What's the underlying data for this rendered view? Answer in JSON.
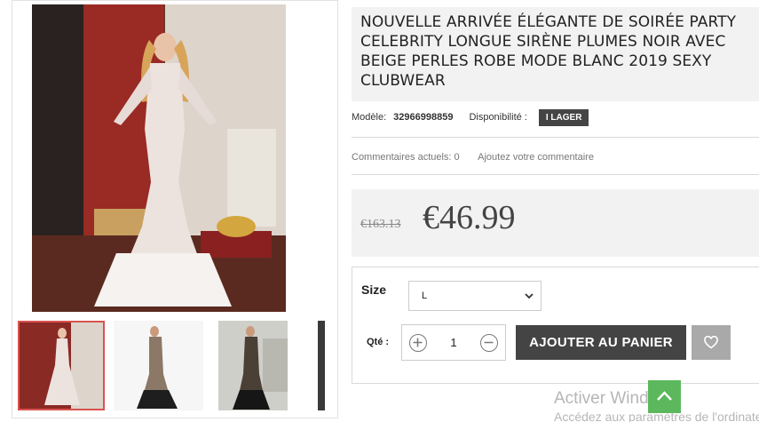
{
  "product": {
    "title": "NOUVELLE ARRIVÉE ÉLÉGANTE DE SOIRÉE PARTY CELEBRITY LONGUE SIRÈNE PLUMES NOIR AVEC BEIGE PERLES ROBE MODE BLANC 2019 SEXY CLUBWEAR",
    "model_label": "Modèle:",
    "model_value": "32966998859",
    "availability_label": "Disponibilité :",
    "availability_value": "I LAGER"
  },
  "reviews": {
    "current": "Commentaires actuels: 0",
    "add": "Ajoutez votre commentaire"
  },
  "price": {
    "old": "€163.13",
    "new": "€46.99"
  },
  "options": {
    "size_label": "Size",
    "size_selected": "L",
    "qty_label": "Qté :",
    "qty_value": "1",
    "add_to_cart": "AJOUTER AU PANIER"
  },
  "gallery": {
    "thumbnails": [
      "white-feather-gown",
      "beaded-gown-front",
      "beaded-gown-side",
      "gown-partial"
    ],
    "active_index": 0
  },
  "overlay": {
    "watermark_title": "Activer Windows",
    "watermark_sub": "Accédez aux paramètres de l'ordinateur"
  },
  "colors": {
    "dark_button": "#444444",
    "active_thumb_border": "#d9534f",
    "scroll_top": "#5cb85c",
    "panel_bg": "#f2f2f2"
  },
  "icons": {
    "wishlist": "heart-icon",
    "qty_plus": "plus-circle-icon",
    "qty_minus": "minus-circle-icon",
    "select": "chevron-down-icon",
    "scroll_top": "chevron-up-icon"
  }
}
